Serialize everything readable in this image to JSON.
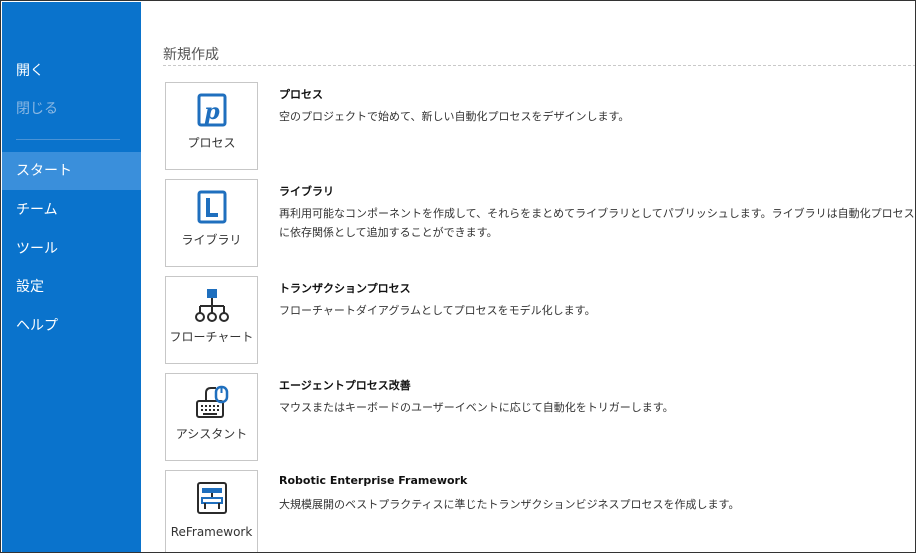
{
  "sidebar": {
    "open": "開く",
    "close": "閉じる",
    "items": [
      "スタート",
      "チーム",
      "ツール",
      "設定",
      "ヘルプ"
    ]
  },
  "main": {
    "section_title": "新規作成",
    "templates": [
      {
        "tile_label": "プロセス",
        "title": "プロセス",
        "description": "空のプロジェクトで始めて、新しい自動化プロセスをデザインします。",
        "icon": "process-icon"
      },
      {
        "tile_label": "ライブラリ",
        "title": "ライブラリ",
        "description": "再利用可能なコンポーネントを作成して、それらをまとめてライブラリとしてパブリッシュします。ライブラリは自動化プロセスに依存関係として追加することができます。",
        "icon": "library-icon"
      },
      {
        "tile_label": "フローチャート",
        "title": "トランザクションプロセス",
        "description": "フローチャートダイアグラムとしてプロセスをモデル化します。",
        "icon": "flowchart-icon"
      },
      {
        "tile_label": "アシスタント",
        "title": "エージェントプロセス改善",
        "description": "マウスまたはキーボードのユーザーイベントに応じて自動化をトリガーします。",
        "icon": "assistant-icon"
      },
      {
        "tile_label": "ReFramework",
        "title": "Robotic Enterprise Framework",
        "description": "大規模展開のベストプラクティスに準じたトランザクションビジネスプロセスを作成します。",
        "icon": "reframework-icon"
      }
    ]
  },
  "colors": {
    "sidebar_bg": "#0a73cc",
    "sidebar_active": "#3a8fdb",
    "icon_blue": "#1f6fbe",
    "icon_dark": "#2b2b2b"
  }
}
